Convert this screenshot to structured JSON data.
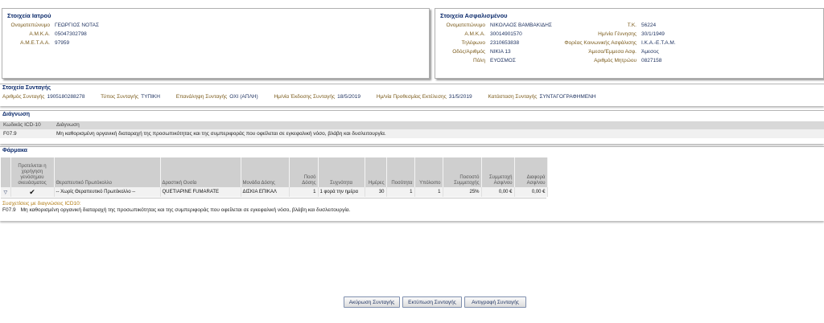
{
  "doctor": {
    "title": "Στοιχεία Ιατρού",
    "fields": [
      {
        "label": "Ονοματεπώνυμο",
        "value": "ΓΕΩΡΓΙΟΣ ΝΟΤΑΣ"
      },
      {
        "label": "Α.Μ.Κ.Α.",
        "value": "05047302798"
      },
      {
        "label": "Α.Μ.Ε.Τ.Α.Α.",
        "value": "97959"
      }
    ]
  },
  "insured": {
    "title": "Στοιχεία Ασφαλισμένου",
    "left_fields": [
      {
        "label": "Ονοματεπώνυμο",
        "value": "ΝΙΚΟΛΑΟΣ ΒΑΜΒΑΚΙΔΗΣ"
      },
      {
        "label": "Α.Μ.Κ.Α.",
        "value": "30014901570"
      },
      {
        "label": "Τηλέφωνο",
        "value": "2310653838"
      },
      {
        "label": "Οδός/Αριθμός",
        "value": "ΝΙΚΙΑ 13"
      },
      {
        "label": "Πόλη",
        "value": "ΕΥΟΣΜΟΣ"
      }
    ],
    "right_fields": [
      {
        "label": "Τ.Κ.",
        "value": "56224"
      },
      {
        "label": "Ημ/νία Γέννησης",
        "value": "30/1/1949"
      },
      {
        "label": "Φορέας Κοινωνικής Ασφάλισης",
        "value": "Ι.Κ.Α.-Ε.Τ.Α.Μ."
      },
      {
        "label": "Άμεσα/Έμμεσα Ασφ.",
        "value": "Άμεσος"
      },
      {
        "label": "Αριθμός Μητρώου",
        "value": "0827158"
      }
    ]
  },
  "prescription": {
    "title": "Στοιχεία Συνταγής",
    "fields": [
      {
        "label": "Αριθμός Συνταγής",
        "value": "1905180288278"
      },
      {
        "label": "Τύπος Συνταγής",
        "value": "ΤΥΠΙΚΗ"
      },
      {
        "label": "Επανάληψη Συνταγής",
        "value": "ΟΧΙ (ΑΠΛΗ)"
      },
      {
        "label": "Ημ/νία Έκδοσης Συνταγής",
        "value": "18/5/2019"
      },
      {
        "label": "Ημ/νία Προθεσμίας Εκτέλεσης",
        "value": "31/5/2019"
      },
      {
        "label": "Κατάσταση Συνταγής",
        "value": "ΣΥΝΤΑΓΟΓΡΑΦΗΜΕΝΗ"
      }
    ]
  },
  "diagnosis": {
    "title": "Διάγνωση",
    "col_code": "Κωδικός ICD-10",
    "col_desc": "Διάγνωση",
    "code": "F07.9",
    "desc": "Μη καθορισμένη οργανική διαταραχή της προσωπικότητας και της συμπεριφοράς που οφείλεται σε εγκεφαλική νόσο, βλάβη και δυσλειτουργία."
  },
  "drugs": {
    "title": "Φάρμακα",
    "headers": {
      "generic": "Προτείνεται η χορήγηση γενόσημου σκευάσματος",
      "protocol": "Θεραπευτικό Πρωτόκολλο",
      "substance": "Δραστική Ουσία",
      "unit": "Μονάδα Δόσης",
      "dose": "Ποσό Δόσης",
      "freq": "Συχνότητα",
      "days": "Ημέρες",
      "qty": "Ποσότητα",
      "remain": "Υπόλοιπο",
      "pct": "Ποσοστό Συμμετοχής",
      "copay": "Συμμετοχή Ασφ/νου",
      "diff": "Διαφορά Ασφ/νου"
    },
    "row": {
      "expand": "▽",
      "generic": "✔",
      "protocol": "-- Χωρίς Θεραπευτικό Πρωτόκολλο --",
      "substance": "QUETIAPINE FUMARATE",
      "unit": "ΔΙΣΚΙΑ ΕΠΙΚΑΛ",
      "dose": "1",
      "freq": "1 φορά την ημέρα",
      "days": "30",
      "qty": "1",
      "remain": "1",
      "pct": "25%",
      "copay": "0,00 €",
      "diff": "0,00 €"
    },
    "assoc_header": "Συσχετίσεις με διαγνώσεις ICD10:",
    "assoc_code": "F07.9",
    "assoc_desc": "Μη καθορισμένη οργανική διαταραχή της προσωπικότητας και της συμπεριφοράς που οφείλεται σε εγκεφαλική νόσο, βλάβη και δυσλειτουργία."
  },
  "buttons": {
    "cancel": "Ακύρωση Συνταγής",
    "print": "Εκτύπωση Συνταγής",
    "copy": "Αντιγραφή Συνταγής"
  }
}
